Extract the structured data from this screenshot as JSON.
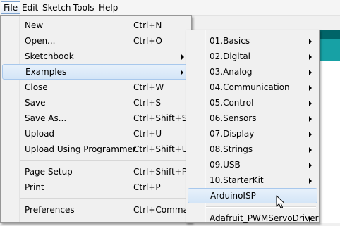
{
  "menubar": {
    "items": [
      {
        "label": "File"
      },
      {
        "label": "Edit"
      },
      {
        "label": "Sketch"
      },
      {
        "label": "Tools"
      },
      {
        "label": "Help"
      }
    ]
  },
  "file_menu": {
    "items": [
      {
        "label": "New",
        "shortcut": "Ctrl+N"
      },
      {
        "label": "Open...",
        "shortcut": "Ctrl+O"
      },
      {
        "label": "Sketchbook",
        "shortcut": ""
      },
      {
        "label": "Examples",
        "shortcut": ""
      },
      {
        "label": "Close",
        "shortcut": "Ctrl+W"
      },
      {
        "label": "Save",
        "shortcut": "Ctrl+S"
      },
      {
        "label": "Save As...",
        "shortcut": "Ctrl+Shift+S"
      },
      {
        "label": "Upload",
        "shortcut": "Ctrl+U"
      },
      {
        "label": "Upload Using Programmer",
        "shortcut": "Ctrl+Shift+U"
      },
      {
        "label": "Page Setup",
        "shortcut": "Ctrl+Shift+P"
      },
      {
        "label": "Print",
        "shortcut": "Ctrl+P"
      },
      {
        "label": "Preferences",
        "shortcut": "Ctrl+Comma"
      }
    ]
  },
  "examples_menu": {
    "items": [
      {
        "label": "01.Basics"
      },
      {
        "label": "02.Digital"
      },
      {
        "label": "03.Analog"
      },
      {
        "label": "04.Communication"
      },
      {
        "label": "05.Control"
      },
      {
        "label": "06.Sensors"
      },
      {
        "label": "07.Display"
      },
      {
        "label": "08.Strings"
      },
      {
        "label": "09.USB"
      },
      {
        "label": "10.StarterKit"
      },
      {
        "label": "ArduinoISP"
      },
      {
        "label": "Adafruit_PWMServoDriver"
      }
    ]
  },
  "colors": {
    "highlight": "#d4e5f7",
    "highlight_border": "#a8c8ec",
    "teal_dark": "#006468",
    "teal_light": "#17a1a5"
  }
}
